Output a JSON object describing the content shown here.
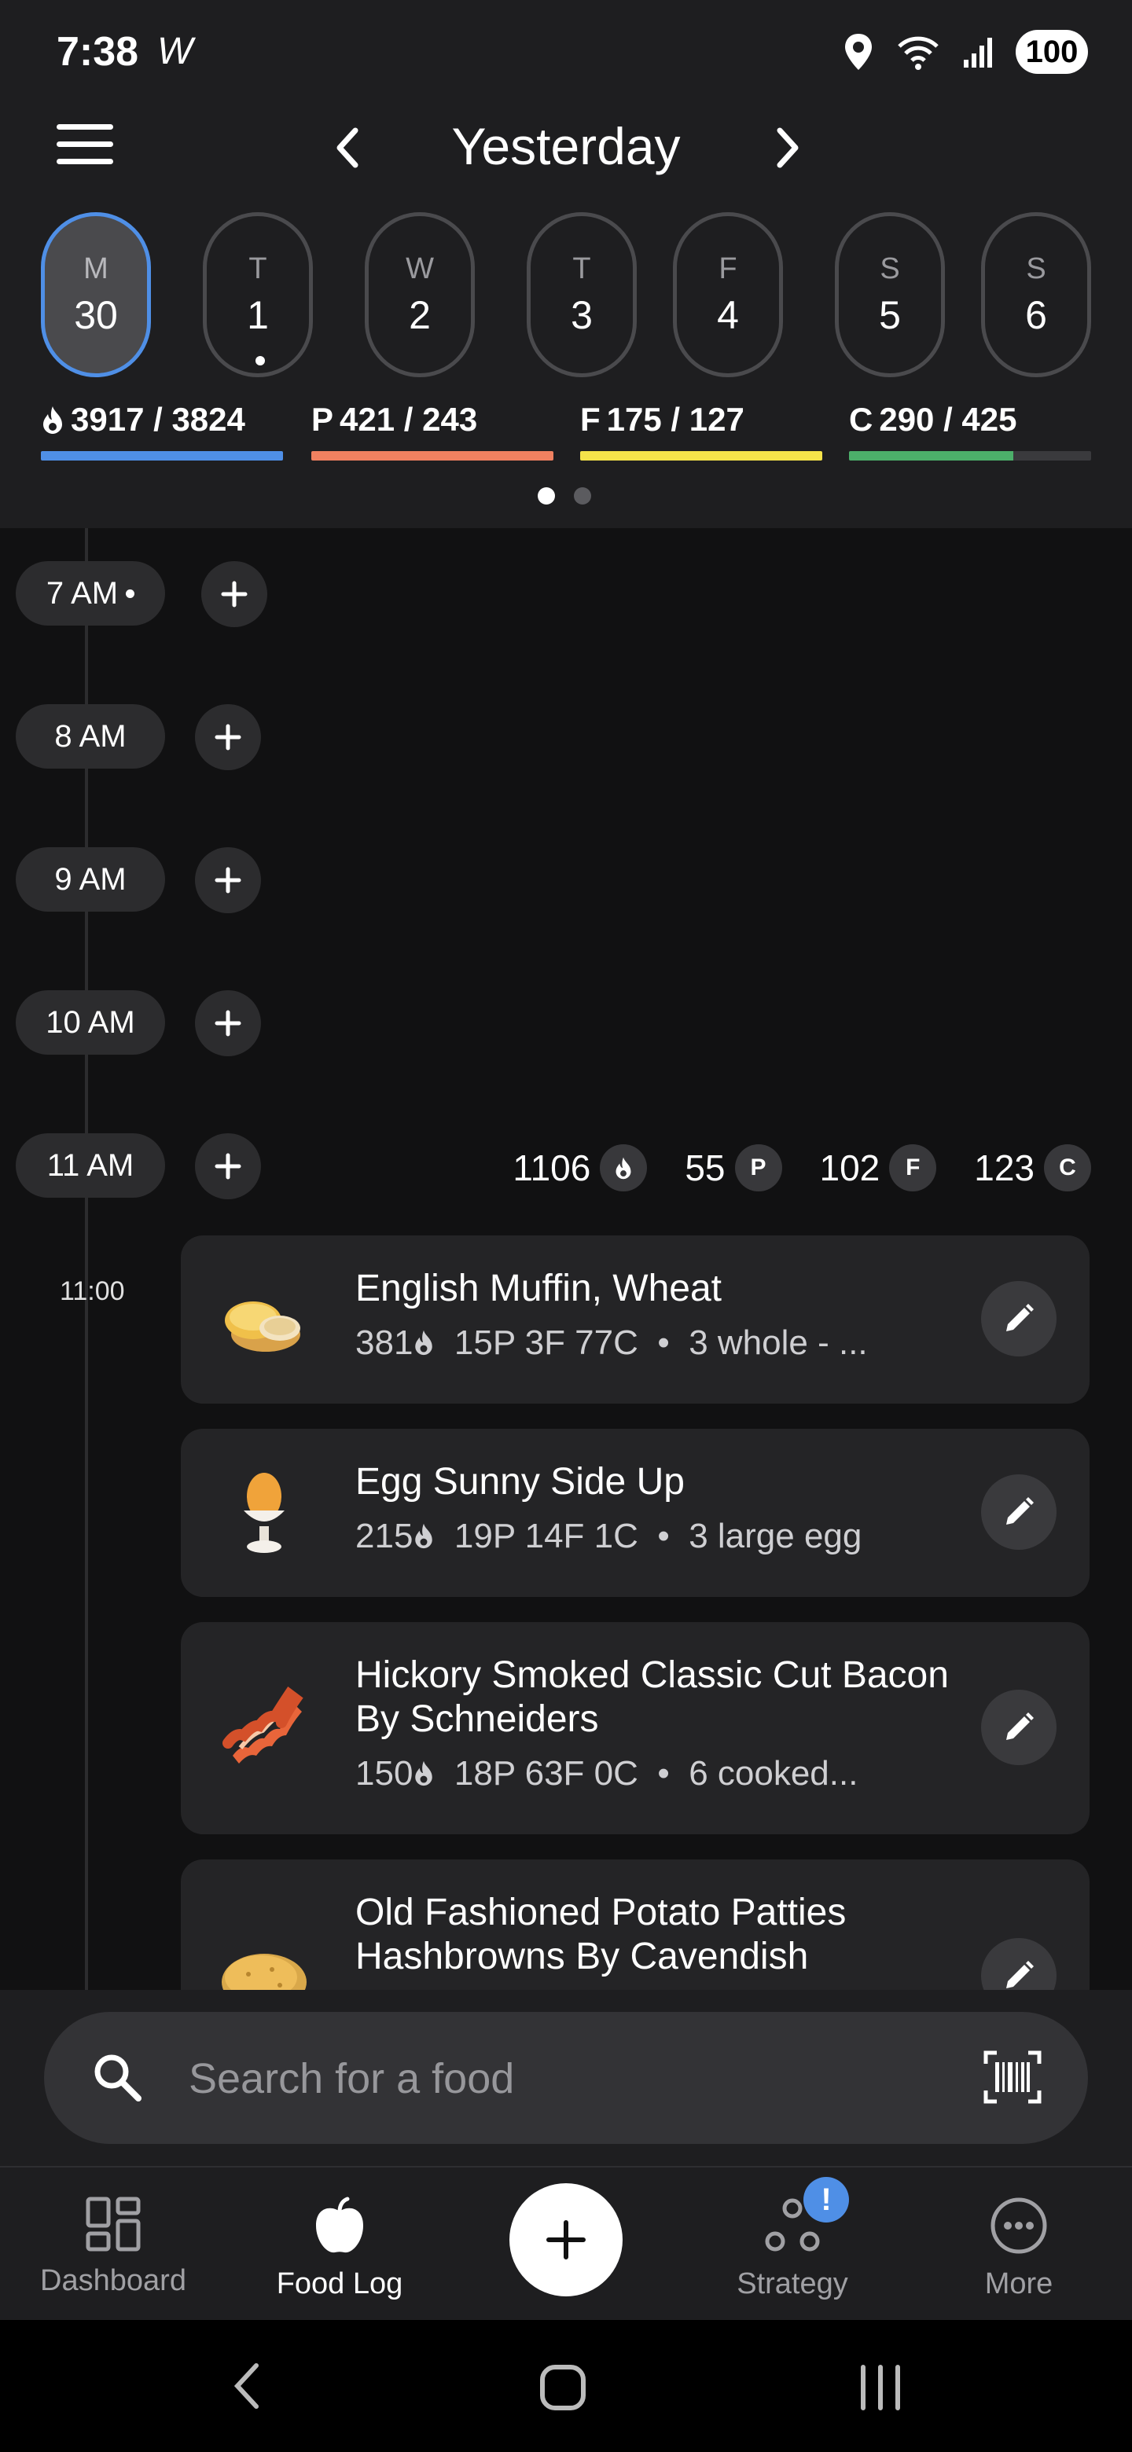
{
  "status_bar": {
    "time": "7:38",
    "carrier_icon": "W",
    "battery": "100"
  },
  "header": {
    "title": "Yesterday"
  },
  "days": [
    {
      "letter": "M",
      "num": "30",
      "selected": true,
      "has_dot": false
    },
    {
      "letter": "T",
      "num": "1",
      "selected": false,
      "has_dot": true
    },
    {
      "letter": "W",
      "num": "2",
      "selected": false,
      "has_dot": false
    },
    {
      "letter": "T",
      "num": "3",
      "selected": false,
      "has_dot": false
    },
    {
      "letter": "F",
      "num": "4",
      "selected": false,
      "has_dot": false
    },
    {
      "letter": "S",
      "num": "5",
      "selected": false,
      "has_dot": false
    },
    {
      "letter": "S",
      "num": "6",
      "selected": false,
      "has_dot": false
    }
  ],
  "macros": {
    "calories": {
      "prefix": "",
      "text": "3917 / 3824",
      "color": "#4f8fe6",
      "progress": 1.0
    },
    "protein": {
      "prefix": "P",
      "text": "421 / 243",
      "color": "#f08160",
      "progress": 1.0
    },
    "fat": {
      "prefix": "F",
      "text": "175 / 127",
      "color": "#f5e34a",
      "progress": 1.0
    },
    "carbs": {
      "prefix": "C",
      "text": "290 / 425",
      "color": "#4caf6a",
      "progress": 0.68
    }
  },
  "hours": {
    "h7": "7 AM",
    "h8": "8 AM",
    "h9": "9 AM",
    "h10": "10 AM",
    "h11": "11 AM"
  },
  "hour11_totals": {
    "calories": "1106",
    "protein": "55",
    "fat": "102",
    "carbs": "123"
  },
  "badges": {
    "protein": "P",
    "fat": "F",
    "carbs": "C"
  },
  "entry_time": "11:00",
  "foods": [
    {
      "name": "English Muffin, Wheat",
      "cal": "381",
      "macros": "15P  3F  77C",
      "serving": "3 whole - ...",
      "icon": "english-muffin-icon"
    },
    {
      "name": "Egg Sunny Side Up",
      "cal": "215",
      "macros": "19P  14F  1C",
      "serving": "3 large egg",
      "icon": "egg-icon"
    },
    {
      "name": "Hickory Smoked Classic Cut Bacon By Schneiders",
      "cal": "150",
      "macros": "18P  63F  0C",
      "serving": "6 cooked...",
      "icon": "bacon-icon"
    },
    {
      "name": "Old Fashioned Potato Patties Hashbrowns By Cavendish",
      "icon": "potato-icon"
    }
  ],
  "search": {
    "placeholder": "Search for a food"
  },
  "nav": {
    "dashboard": "Dashboard",
    "food_log": "Food Log",
    "strategy": "Strategy",
    "more": "More",
    "strategy_badge": "!"
  }
}
